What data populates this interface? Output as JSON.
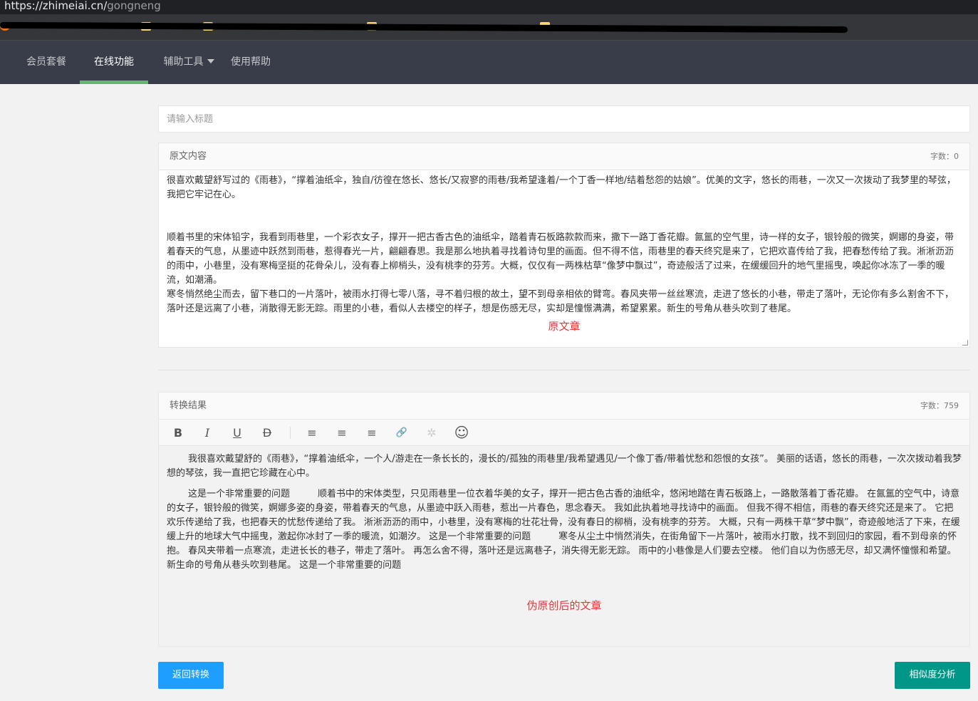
{
  "browser": {
    "url_host": "https://zhimeiai.cn/",
    "url_path": "gongneng"
  },
  "nav": {
    "items": [
      {
        "label": "会员套餐"
      },
      {
        "label": "在线功能",
        "active": true
      },
      {
        "label": "辅助工具"
      },
      {
        "label": "使用帮助"
      }
    ]
  },
  "title_input": {
    "placeholder": "请输入标题",
    "value": ""
  },
  "original": {
    "header": "原文内容",
    "count": "字数：0",
    "paragraphs": [
      "很喜欢戴望舒写过的《雨巷》，“撑着油纸伞，独自/彷徨在悠长、悠长/又寂寥的雨巷/我希望逢着/一个丁香一样地/结着愁怨的姑娘”。优美的文字，悠长的雨巷，一次又一次拨动了我梦里的琴弦，我把它牢记在心。",
      "顺着书里的宋体铅字，我看到雨巷里，一个彩衣女子，撑开一把古香古色的油纸伞，踏着青石板路款款而来，撒下一路丁香花瓣。氤氲的空气里，诗一样的女子，银铃般的微笑，婀娜的身姿，带着春天的气息，从墨迹中跃然到雨巷，惹得春光一片，翩翩春思。我是那么地执着寻找着诗句里的画面。但不得不信，雨巷里的春天终究是来了，它把欢喜传给了我，把春愁传给了我。淅淅沥沥的雨中，小巷里，没有寒梅坚挺的花骨朵儿，没有春上柳梢头，没有桃李的芬芳。大概，仅仅有一两株枯草“像梦中飘过”，奇迹般活了过来，在缓缓回升的地气里摇曳，唤起你冰冻了一季的暖流，如潮涌。",
      "寒冬悄然绝尘而去，留下巷口的一片落叶，被雨水打得七零八落，寻不着归根的故土，望不到母亲相依的臂弯。春风夹带一丝丝寒流，走进了悠长的小巷，带走了落叶，无论你有多么割舍不下，落叶还是远离了小巷，消散得无影无踪。雨里的小巷，看似人去楼空的样子，想是伤感无尽，实却是憧憬满满，希望累累。新生的号角从巷头吹到了巷尾。"
    ],
    "annotation": "原文章"
  },
  "result": {
    "header": "转换结果",
    "count": "字数：759",
    "toolbar": [
      {
        "icon": "bold-icon",
        "glyph": "B"
      },
      {
        "icon": "italic-icon",
        "glyph": "I"
      },
      {
        "icon": "underline-icon",
        "glyph": "U"
      },
      {
        "icon": "strikethrough-icon",
        "glyph": "D"
      },
      {
        "icon": "align-left-icon",
        "glyph": "≡"
      },
      {
        "icon": "align-center-icon",
        "glyph": "≡"
      },
      {
        "icon": "align-right-icon",
        "glyph": "≡"
      },
      {
        "icon": "link-icon",
        "glyph": "🔗"
      },
      {
        "icon": "unlink-icon",
        "glyph": "✲"
      },
      {
        "icon": "emoji-icon",
        "glyph": "☺"
      }
    ],
    "paragraphs": [
      "我很喜欢戴望舒的《雨巷》，“撑着油纸伞，一个人/游走在一条长长的，漫长的/孤独的雨巷里/我希望遇见/一个像丁香/带着忧愁和怨恨的女孩”。 美丽的话语，悠长的雨巷，一次次拨动着我梦想的琴弦，我一直把它珍藏在心中。",
      "这是一个非常重要的问题　　　顺着书中的宋体类型，只见雨巷里一位衣着华美的女子，撑开一把古色古香的油纸伞，悠闲地踏在青石板路上，一路散落着丁香花瓣。 在氤氲的空气中，诗意的女子，银铃般的微笑，婀娜多姿的身姿，带着春天的气息，从墨迹中跃入雨巷，惹出一片春色，思念春天。 我如此执着地寻找诗中的画面。 但我不得不相信，雨巷的春天终究还是来了。 它把欢乐传递给了我，也把春天的忧愁传递给了我。 淅淅沥沥的雨中，小巷里，没有寒梅的壮花壮骨，没有春日的柳梢，没有桃李的芬芳。 大概，只有一两株干草“梦中飘”，奇迹般地活了下来，在缓缓上升的地球大气中摇曳，激起你冰封了一季的暖流，如潮汐。 这是一个非常重要的问题　　　寒冬从尘土中悄然消失，在街角留下一片落叶，被雨水打散，找不到回归的家园，看不到母亲的怀抱。 春风夹带着一点寒流，走进长长的巷子，带走了落叶。 再怎么舍不得，落叶还是远离巷子，消失得无影无踪。 雨中的小巷像是人们要去空楼。 他们自以为伤感无尽，却又满怀憧憬和希望。 新生命的号角从巷头吹到巷尾。 这是一个非常重要的问题"
    ],
    "annotation": "伪原创后的文章"
  },
  "buttons": {
    "back": "返回转换",
    "similarity": "相似度分析"
  },
  "colors": {
    "nav_bg": "#393d49",
    "nav_active": "#5fb878",
    "btn_blue": "#1e9fff",
    "btn_green": "#009688",
    "annotation_red": "#e4393c"
  }
}
